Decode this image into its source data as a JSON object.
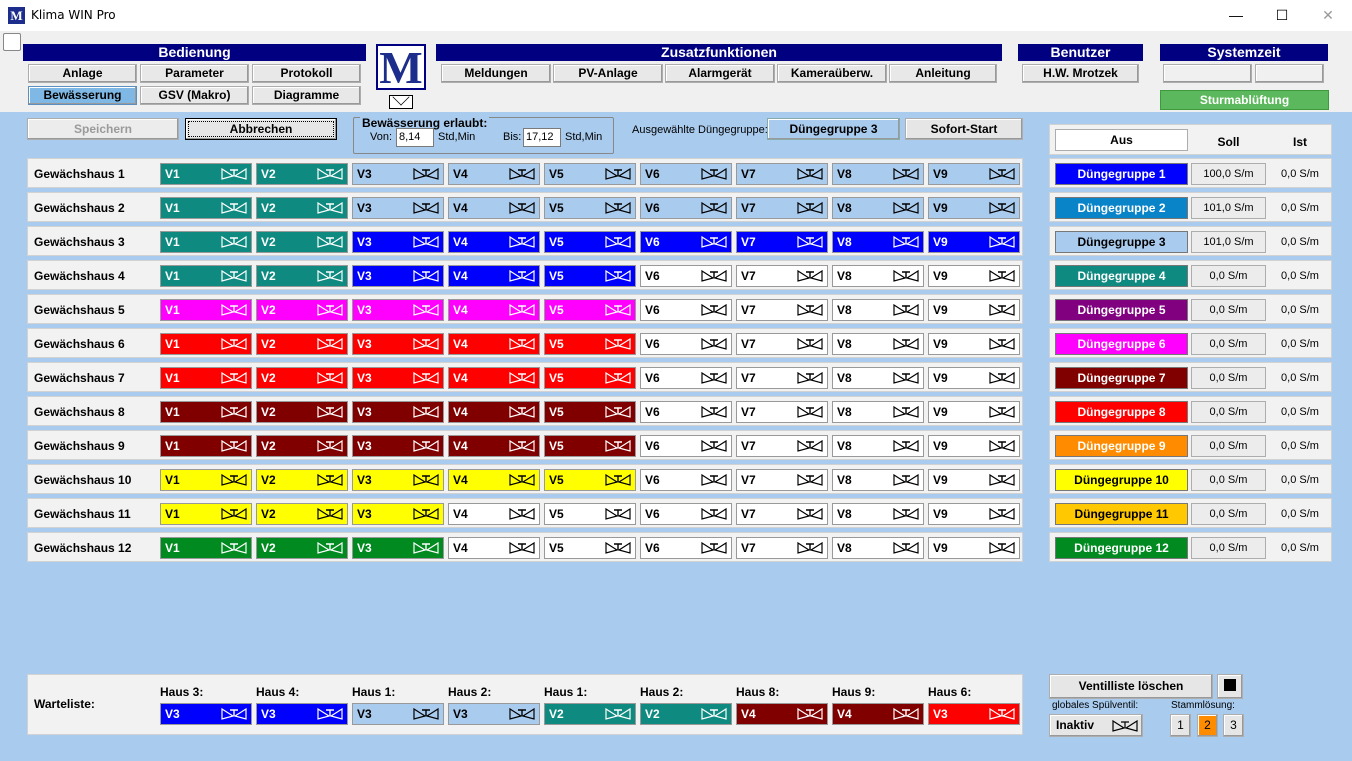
{
  "window": {
    "title": "Klima WIN Pro",
    "logo_letter": "M",
    "min": "—",
    "max": "☐",
    "close": "✕"
  },
  "menu": {
    "bedienung": {
      "title": "Bedienung",
      "items": [
        "Anlage",
        "Parameter",
        "Protokoll",
        "Bewässerung",
        "GSV (Makro)",
        "Diagramme"
      ],
      "active": "Bewässerung"
    },
    "zusatz": {
      "title": "Zusatzfunktionen",
      "items": [
        "Meldungen",
        "PV-Anlage",
        "Alarmgerät",
        "Kameraüberw.",
        "Anleitung"
      ]
    },
    "benutzer": {
      "title": "Benutzer",
      "user": "H.W. Mrotzek"
    },
    "systemzeit": {
      "title": "Systemzeit"
    },
    "storm_label": "Sturmablüftung"
  },
  "toolbar": {
    "save": "Speichern",
    "cancel": "Abbrechen",
    "allowed_title": "Bewässerung erlaubt:",
    "from_label": "Von:",
    "from_value": "8,14",
    "from_unit": "Std,Min",
    "to_label": "Bis:",
    "to_value": "17,12",
    "to_unit": "Std,Min",
    "group_label": "Ausgewählte Düngegruppe:",
    "group_value": "Düngegruppe 3",
    "start": "Sofort-Start"
  },
  "colors": {
    "teal": "#0f8a80",
    "lightblue": "#a9cbee",
    "blue": "#0000ff",
    "magenta": "#ff00ff",
    "red": "#ff0000",
    "maroon": "#800000",
    "yellow": "#ffff00",
    "green": "#008a20",
    "white": "#ffffff"
  },
  "greenhouses": [
    {
      "name": "Gewächshaus 1",
      "valves": [
        "teal",
        "teal",
        "lightblue",
        "lightblue",
        "lightblue",
        "lightblue",
        "lightblue",
        "lightblue",
        "lightblue"
      ]
    },
    {
      "name": "Gewächshaus 2",
      "valves": [
        "teal",
        "teal",
        "lightblue",
        "lightblue",
        "lightblue",
        "lightblue",
        "lightblue",
        "lightblue",
        "lightblue"
      ]
    },
    {
      "name": "Gewächshaus 3",
      "valves": [
        "teal",
        "teal",
        "blue",
        "blue",
        "blue",
        "blue",
        "blue",
        "blue",
        "blue"
      ]
    },
    {
      "name": "Gewächshaus 4",
      "valves": [
        "teal",
        "teal",
        "blue",
        "blue",
        "blue",
        "white",
        "white",
        "white",
        "white"
      ]
    },
    {
      "name": "Gewächshaus 5",
      "valves": [
        "magenta",
        "magenta",
        "magenta",
        "magenta",
        "magenta",
        "white",
        "white",
        "white",
        "white"
      ]
    },
    {
      "name": "Gewächshaus 6",
      "valves": [
        "red",
        "red",
        "red",
        "red",
        "red",
        "white",
        "white",
        "white",
        "white"
      ]
    },
    {
      "name": "Gewächshaus 7",
      "valves": [
        "red",
        "red",
        "red",
        "red",
        "red",
        "white",
        "white",
        "white",
        "white"
      ]
    },
    {
      "name": "Gewächshaus 8",
      "valves": [
        "maroon",
        "maroon",
        "maroon",
        "maroon",
        "maroon",
        "white",
        "white",
        "white",
        "white"
      ]
    },
    {
      "name": "Gewächshaus 9",
      "valves": [
        "maroon",
        "maroon",
        "maroon",
        "maroon",
        "maroon",
        "white",
        "white",
        "white",
        "white"
      ]
    },
    {
      "name": "Gewächshaus 10",
      "valves": [
        "yellow",
        "yellow",
        "yellow",
        "yellow",
        "yellow",
        "white",
        "white",
        "white",
        "white"
      ]
    },
    {
      "name": "Gewächshaus 11",
      "valves": [
        "yellow",
        "yellow",
        "yellow",
        "white",
        "white",
        "white",
        "white",
        "white",
        "white"
      ]
    },
    {
      "name": "Gewächshaus 12",
      "valves": [
        "green",
        "green",
        "green",
        "white",
        "white",
        "white",
        "white",
        "white",
        "white"
      ]
    }
  ],
  "valve_labels": [
    "V1",
    "V2",
    "V3",
    "V4",
    "V5",
    "V6",
    "V7",
    "V8",
    "V9"
  ],
  "groups_header": {
    "off": "Aus",
    "soll": "Soll",
    "ist": "Ist"
  },
  "groups": [
    {
      "name": "Düngegruppe 1",
      "color": "#0000ff",
      "text": "#ffffff",
      "soll": "100,0 S/m",
      "ist": "0,0 S/m"
    },
    {
      "name": "Düngegruppe 2",
      "color": "#0a84c8",
      "text": "#ffffff",
      "soll": "101,0 S/m",
      "ist": "0,0 S/m"
    },
    {
      "name": "Düngegruppe 3",
      "color": "#a9cbee",
      "text": "#000000",
      "soll": "101,0 S/m",
      "ist": "0,0 S/m"
    },
    {
      "name": "Düngegruppe 4",
      "color": "#0f8a80",
      "text": "#ffffff",
      "soll": "0,0 S/m",
      "ist": "0,0 S/m"
    },
    {
      "name": "Düngegruppe 5",
      "color": "#800080",
      "text": "#ffffff",
      "soll": "0,0 S/m",
      "ist": "0,0 S/m"
    },
    {
      "name": "Düngegruppe 6",
      "color": "#ff00ff",
      "text": "#ffffff",
      "soll": "0,0 S/m",
      "ist": "0,0 S/m"
    },
    {
      "name": "Düngegruppe 7",
      "color": "#800000",
      "text": "#ffffff",
      "soll": "0,0 S/m",
      "ist": "0,0 S/m"
    },
    {
      "name": "Düngegruppe 8",
      "color": "#ff0000",
      "text": "#ffffff",
      "soll": "0,0 S/m",
      "ist": "0,0 S/m"
    },
    {
      "name": "Düngegruppe 9",
      "color": "#ff8c00",
      "text": "#ffffff",
      "soll": "0,0 S/m",
      "ist": "0,0 S/m"
    },
    {
      "name": "Düngegruppe 10",
      "color": "#ffff00",
      "text": "#000000",
      "soll": "0,0 S/m",
      "ist": "0,0 S/m"
    },
    {
      "name": "Düngegruppe 11",
      "color": "#ffc800",
      "text": "#000000",
      "soll": "0,0 S/m",
      "ist": "0,0 S/m"
    },
    {
      "name": "Düngegruppe 12",
      "color": "#008a20",
      "text": "#ffffff",
      "soll": "0,0 S/m",
      "ist": "0,0 S/m"
    }
  ],
  "waitlist": {
    "label": "Warteliste:",
    "items": [
      {
        "house": "Haus 3:",
        "valve": "V3",
        "color": "blue"
      },
      {
        "house": "Haus 4:",
        "valve": "V3",
        "color": "blue"
      },
      {
        "house": "Haus 1:",
        "valve": "V3",
        "color": "lightblue"
      },
      {
        "house": "Haus 2:",
        "valve": "V3",
        "color": "lightblue"
      },
      {
        "house": "Haus 1:",
        "valve": "V2",
        "color": "teal"
      },
      {
        "house": "Haus 2:",
        "valve": "V2",
        "color": "teal"
      },
      {
        "house": "Haus 8:",
        "valve": "V4",
        "color": "maroon"
      },
      {
        "house": "Haus 9:",
        "valve": "V4",
        "color": "maroon"
      },
      {
        "house": "Haus 6:",
        "valve": "V3",
        "color": "red"
      }
    ]
  },
  "bottom_right": {
    "clear_list": "Ventilliste löschen",
    "global_flush_label": "globales Spülventil:",
    "global_flush_value": "Inaktiv",
    "stock_label": "Stammlösung:",
    "stock_options": [
      "1",
      "2",
      "3"
    ],
    "stock_selected": "2"
  }
}
